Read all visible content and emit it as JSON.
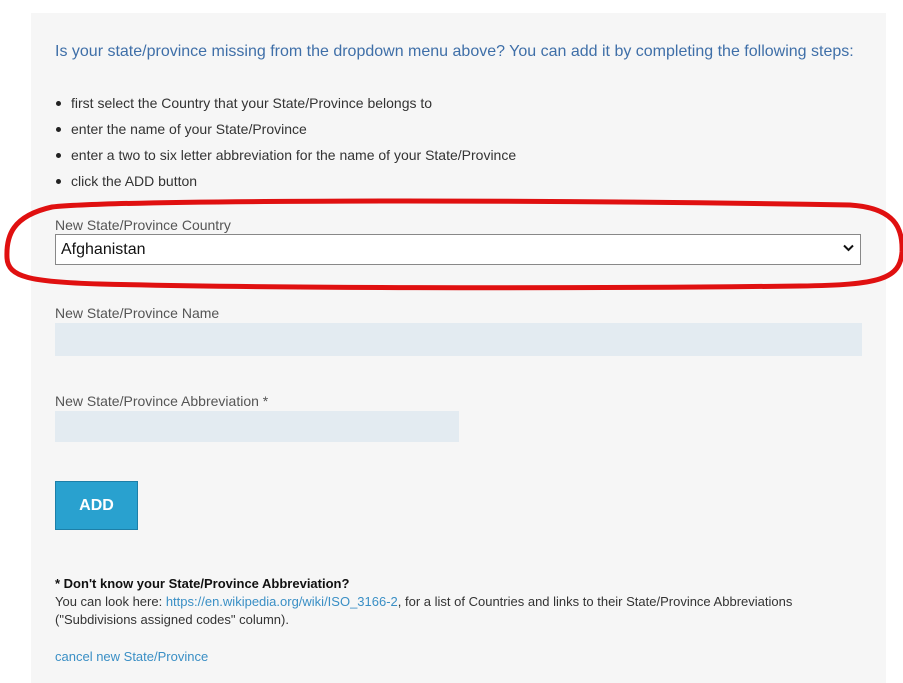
{
  "intro": "Is your state/province missing from the dropdown menu above? You can add it by completing the following steps:",
  "steps": [
    "first select the Country that your State/Province belongs to",
    "enter the name of your State/Province",
    "enter a two to six letter abbreviation for the name of your State/Province",
    "click the ADD button"
  ],
  "country_field": {
    "label": "New State/Province Country",
    "selected": "Afghanistan"
  },
  "name_field": {
    "label": "New State/Province Name",
    "value": ""
  },
  "abbr_field": {
    "label": "New State/Province Abbreviation *",
    "value": ""
  },
  "add_button": "ADD",
  "note": {
    "title": "* Don't know your State/Province Abbreviation?",
    "prefix": "You can look here: ",
    "link": "https://en.wikipedia.org/wiki/ISO_3166-2",
    "suffix": ", for a list of Countries and links to their State/Province Abbreviations (\"Subdivisions assigned codes\" column)."
  },
  "cancel_link": "cancel new State/Province",
  "colors": {
    "accent": "#29a1cf",
    "intro_text": "#3f6fa8",
    "highlight_annotation": "#e01010"
  }
}
